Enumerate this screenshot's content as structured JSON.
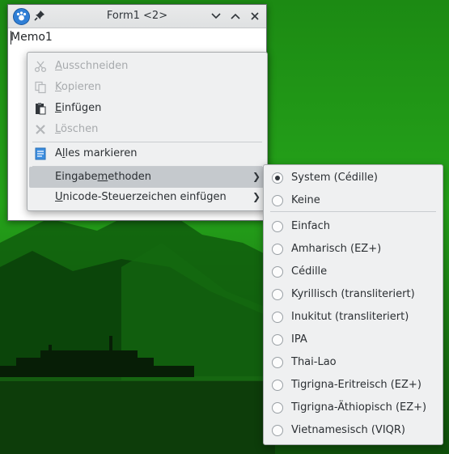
{
  "window": {
    "title": "Form1 <2>"
  },
  "memo": {
    "text": "Memo1"
  },
  "context_menu": {
    "items": [
      {
        "u": "A",
        "rest": "usschneiden",
        "enabled": false,
        "icon": "cut-icon"
      },
      {
        "u": "K",
        "rest": "opieren",
        "enabled": false,
        "icon": "copy-icon"
      },
      {
        "u": "E",
        "rest": "infügen",
        "enabled": true,
        "icon": "paste-icon"
      },
      {
        "u": "L",
        "rest": "öschen",
        "enabled": false,
        "icon": "delete-icon"
      },
      {
        "pre": "A",
        "u": "l",
        "rest": "les markieren",
        "enabled": true,
        "icon": "select-all-icon"
      },
      {
        "pre": "Eingabe",
        "u": "m",
        "rest": "ethoden",
        "enabled": true,
        "highlighted": true,
        "submenu": true
      },
      {
        "u": "U",
        "rest": "nicode-Steuerzeichen einfügen",
        "enabled": true,
        "submenu": true
      }
    ]
  },
  "input_methods": {
    "selected": "System (Cédille)",
    "options": [
      "System (Cédille)",
      "Keine",
      "Einfach",
      "Amharisch (EZ+)",
      "Cédille",
      "Kyrillisch (transliteriert)",
      "Inukitut (transliteriert)",
      "IPA",
      "Thai-Lao",
      "Tigrigna-Eritreisch (EZ+)",
      "Tigrigna-Äthiopisch (EZ+)",
      "Vietnamesisch (VIQR)"
    ]
  }
}
